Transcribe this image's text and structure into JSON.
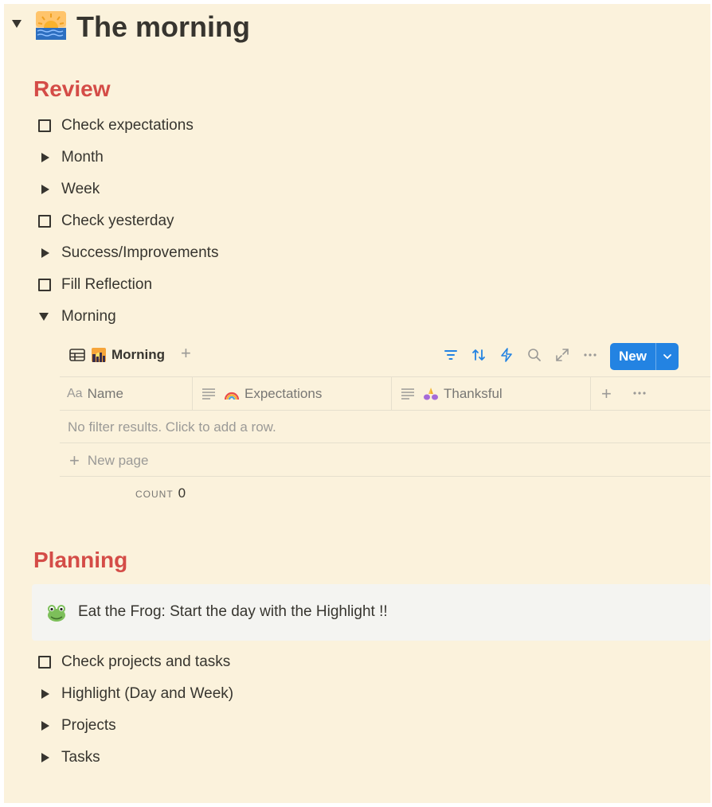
{
  "page": {
    "title": "The morning",
    "icon": "sunrise-over-sea-icon"
  },
  "review": {
    "heading": "Review",
    "items": [
      {
        "type": "todo",
        "label": "Check expectations"
      },
      {
        "type": "toggle",
        "label": "Month"
      },
      {
        "type": "toggle",
        "label": "Week"
      },
      {
        "type": "todo",
        "label": "Check yesterday"
      },
      {
        "type": "toggle",
        "label": "Success/Improvements"
      },
      {
        "type": "todo",
        "label": "Fill Reflection"
      },
      {
        "type": "toggle-open",
        "label": "Morning"
      }
    ]
  },
  "database": {
    "view_name": "Morning",
    "view_icon": "city-sunrise-icon",
    "new_button": "New",
    "toolbar_icons": [
      "filter-icon",
      "sort-icon",
      "automation-bolt-icon",
      "search-icon",
      "expand-icon",
      "more-icon"
    ],
    "columns": [
      {
        "label": "Name",
        "icon": "text-aa-icon"
      },
      {
        "label": "Expectations",
        "icon": "rainbow-icon"
      },
      {
        "label": "Thanksful",
        "icon": "folded-hands-icon"
      }
    ],
    "name_icon_text": "Aa",
    "empty_message": "No filter results. Click to add a row.",
    "new_page_label": "New page",
    "count_label": "COUNT",
    "count_value": "0"
  },
  "planning": {
    "heading": "Planning",
    "callout": {
      "icon": "frog-icon",
      "text": "Eat the Frog: Start the day with the Highlight !!"
    },
    "items": [
      {
        "type": "todo",
        "label": "Check projects and tasks"
      },
      {
        "type": "toggle",
        "label": "Highlight (Day and Week)"
      },
      {
        "type": "toggle",
        "label": "Projects"
      },
      {
        "type": "toggle",
        "label": "Tasks"
      }
    ]
  },
  "colors": {
    "page_background": "#fbf2dc",
    "heading_red": "#d44c47",
    "accent_blue": "#2383e2",
    "callout_background": "#f4f4f1"
  }
}
